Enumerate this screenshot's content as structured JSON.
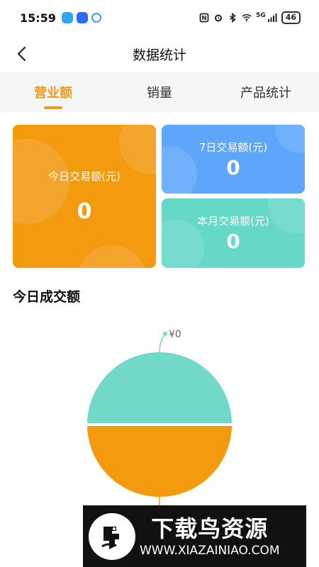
{
  "status_bar": {
    "time": "15:59",
    "network": "5G",
    "battery": "46",
    "icons": [
      "nfc-icon",
      "alarm-icon",
      "bluetooth-icon",
      "wifi-icon",
      "signal-icon"
    ]
  },
  "header": {
    "title": "数据统计",
    "back_icon": "chevron-left-icon"
  },
  "tabs": [
    {
      "label": "营业额",
      "active": true
    },
    {
      "label": "销量",
      "active": false
    },
    {
      "label": "产品统计",
      "active": false
    }
  ],
  "stats": {
    "today": {
      "label": "今日交易额(元)",
      "value": "0",
      "color": "#f39a0f"
    },
    "week": {
      "label": "7日交易额(元)",
      "value": "0",
      "color": "#5ea6fb"
    },
    "month": {
      "label": "本月交易额(元)",
      "value": "0",
      "color": "#65d8c6"
    }
  },
  "section": {
    "title": "今日成交额"
  },
  "chart_data": {
    "type": "pie",
    "labels": [
      "¥0"
    ],
    "values": [
      0,
      0
    ],
    "colors": [
      "#72d9c8",
      "#f39a0f"
    ]
  },
  "watermark": {
    "text": "下载鸟资源",
    "url": "WWW.XIAZAINIAO.COM"
  }
}
